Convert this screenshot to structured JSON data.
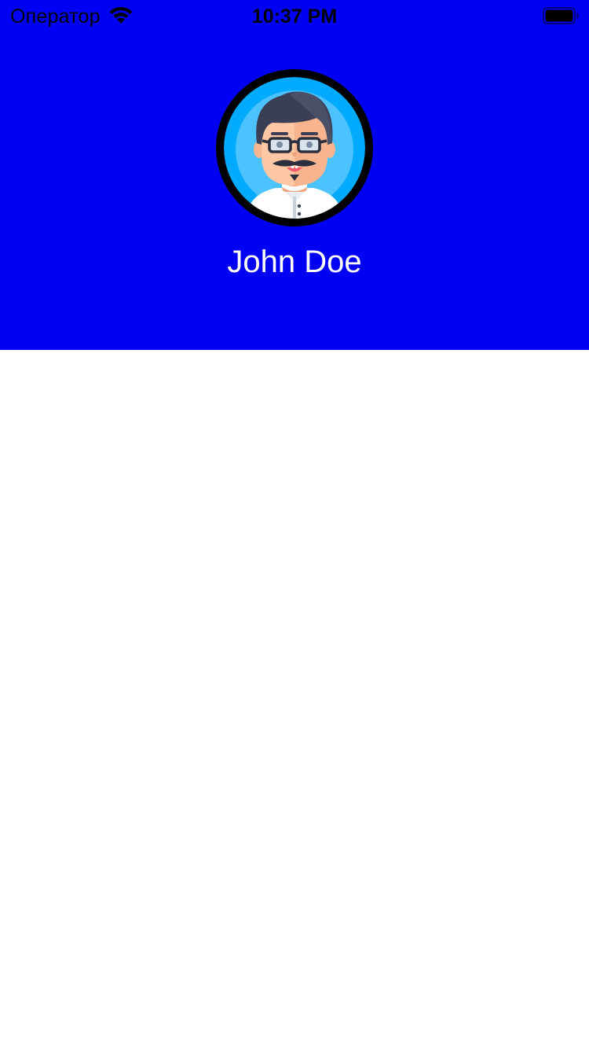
{
  "status_bar": {
    "carrier": "Оператор",
    "time": "10:37 PM",
    "wifi_icon": "wifi-icon",
    "battery_icon": "battery-icon",
    "battery_level": 1.0
  },
  "profile": {
    "name": "John Doe",
    "avatar_icon": "avatar-man-glasses-mustache"
  },
  "colors": {
    "header_background": "#0000f5",
    "avatar_ring": "#000000",
    "avatar_background": "#00aaff",
    "name_text": "#ffffff",
    "content_background": "#ffffff"
  }
}
